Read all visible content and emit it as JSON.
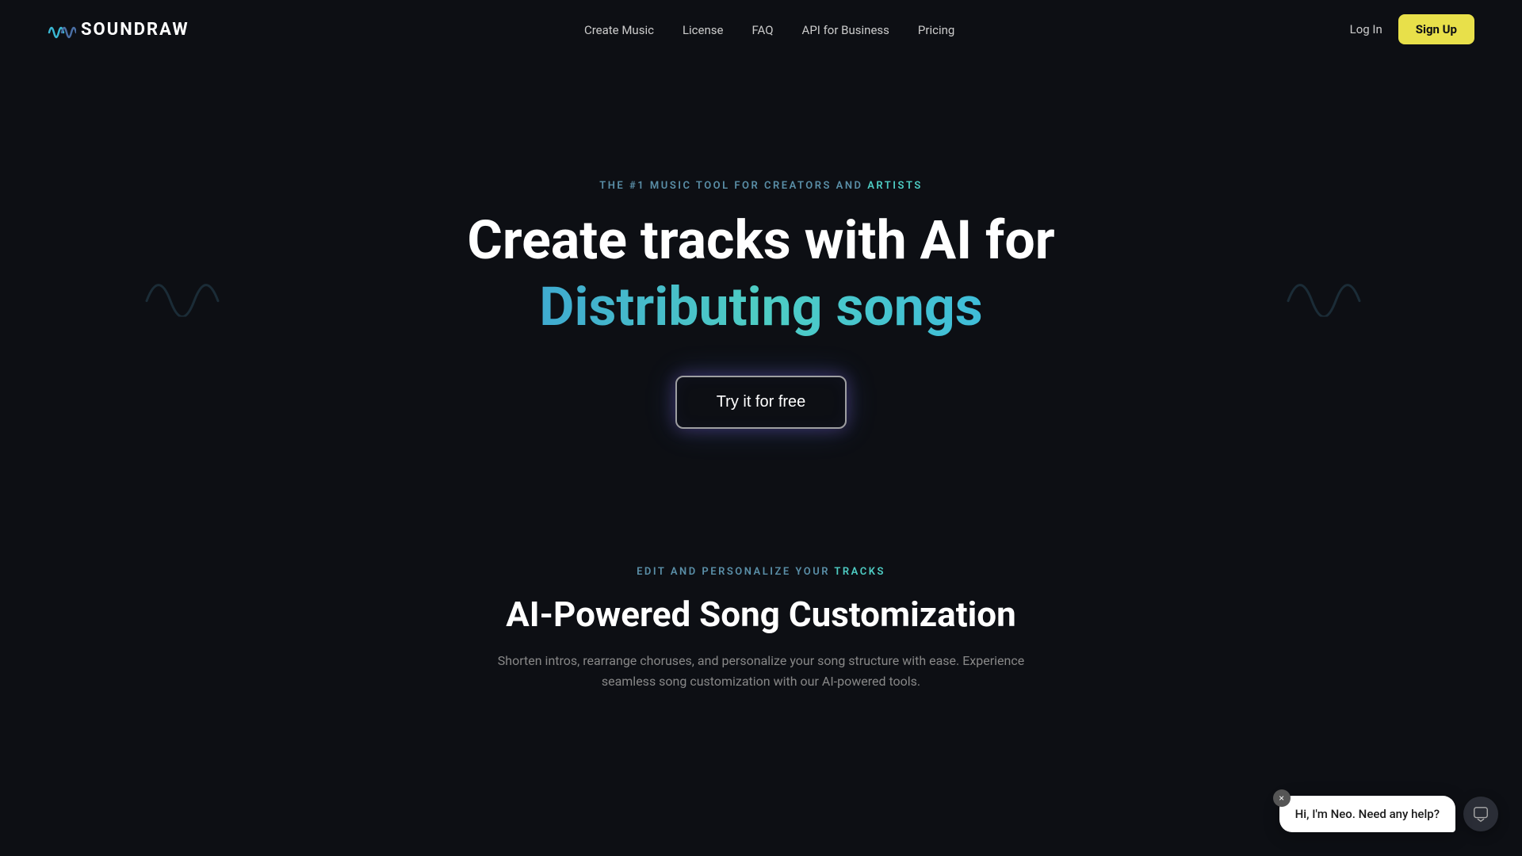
{
  "brand": {
    "name": "SOUNDRAW",
    "logo_symbol": "∿∿"
  },
  "nav": {
    "links": [
      {
        "label": "Create Music",
        "href": "#"
      },
      {
        "label": "License",
        "href": "#"
      },
      {
        "label": "FAQ",
        "href": "#"
      },
      {
        "label": "API for Business",
        "href": "#"
      },
      {
        "label": "Pricing",
        "href": "#"
      }
    ],
    "login_label": "Log In",
    "signup_label": "Sign Up"
  },
  "hero": {
    "eyebrow_prefix": "THE #1 MUSIC TOOL FOR CREATORS AND ",
    "eyebrow_highlight": "ARTISTS",
    "title_line1": "Create tracks with AI for",
    "title_line2": "Distributing songs",
    "cta_label": "Try it for free"
  },
  "lower": {
    "eyebrow_prefix": "EDIT AND PERSONALIZE YOUR ",
    "eyebrow_highlight": "TRACKS",
    "title": "AI-Powered Song Customization",
    "description": "Shorten intros, rearrange choruses, and personalize your song structure with ease. Experience seamless song customization with our AI-powered tools."
  },
  "chat": {
    "message": "Hi, I'm Neo. Need any help?",
    "close_label": "×"
  },
  "colors": {
    "accent_yellow": "#e8e04a",
    "accent_blue": "#3ab8d4",
    "eyebrow_blue": "#4ecdc4"
  }
}
